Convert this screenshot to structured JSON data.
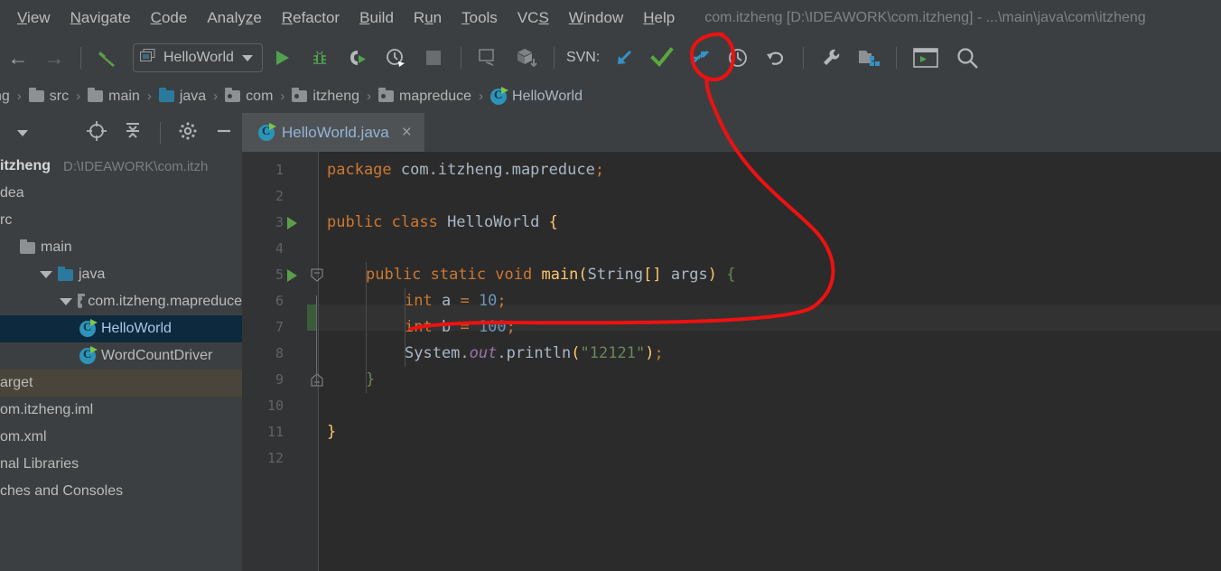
{
  "window": {
    "title": "com.itzheng [D:\\IDEAWORK\\com.itzheng] - ...\\main\\java\\com\\itzheng"
  },
  "menubar": {
    "items": [
      {
        "label": "View",
        "mnemonic": "V"
      },
      {
        "label": "Navigate",
        "mnemonic": "N"
      },
      {
        "label": "Code",
        "mnemonic": "C"
      },
      {
        "label": "Analyze",
        "mnemonic": "z"
      },
      {
        "label": "Refactor",
        "mnemonic": "R"
      },
      {
        "label": "Build",
        "mnemonic": "B"
      },
      {
        "label": "Run",
        "mnemonic": "u"
      },
      {
        "label": "Tools",
        "mnemonic": "T"
      },
      {
        "label": "VCS",
        "mnemonic": "S"
      },
      {
        "label": "Window",
        "mnemonic": "W"
      },
      {
        "label": "Help",
        "mnemonic": "H"
      }
    ]
  },
  "toolbar": {
    "back_icon": "arrow-left-icon",
    "forward_icon": "arrow-right-icon",
    "build_icon": "hammer-icon",
    "run_config": {
      "label": "HelloWorld",
      "icon": "application-icon",
      "caret": "chevron-down-icon"
    },
    "run_icon": "run-icon",
    "debug_icon": "debug-bug-icon",
    "run_coverage_icon": "run-with-coverage-icon",
    "profile_icon": "profiler-icon",
    "stop_icon": "stop-icon",
    "attach_icon": "attach-debugger-icon",
    "update_project_icon": "update-project-icon",
    "svn_label": "SVN:",
    "svn_update_icon": "svn-update-icon",
    "svn_commit_icon": "svn-commit-checkmark-icon",
    "svn_integrate_icon": "svn-integrate-icon",
    "svn_history_icon": "svn-history-clock-icon",
    "svn_rollback_icon": "svn-rollback-icon",
    "settings_icon": "wrench-settings-icon",
    "project_structure_icon": "project-structure-icon",
    "terminal_icon": "terminal-icon",
    "search_icon": "search-icon"
  },
  "breadcrumb": {
    "items": [
      {
        "label": "ng",
        "icon": "none"
      },
      {
        "label": "src",
        "icon": "folder-icon"
      },
      {
        "label": "main",
        "icon": "folder-icon"
      },
      {
        "label": "java",
        "icon": "source-folder-icon"
      },
      {
        "label": "com",
        "icon": "package-icon"
      },
      {
        "label": "itzheng",
        "icon": "package-icon"
      },
      {
        "label": "mapreduce",
        "icon": "package-icon"
      },
      {
        "label": "HelloWorld",
        "icon": "java-class-icon"
      }
    ],
    "separator": "›"
  },
  "project_panel": {
    "toolbar_icons": [
      "chevron-down-icon",
      "locate-target-icon",
      "collapse-all-icon",
      "gear-icon",
      "minimize-icon"
    ],
    "tree": [
      {
        "label": "itzheng",
        "detail": "D:\\IDEAWORK\\com.itzh",
        "icon": "project-root-icon",
        "indent": 0,
        "bold": true,
        "state": "normal"
      },
      {
        "label": "dea",
        "icon": "folder-icon",
        "indent": 1,
        "state": "normal"
      },
      {
        "label": "rc",
        "icon": "folder-icon",
        "indent": 1,
        "state": "normal"
      },
      {
        "label": "main",
        "icon": "folder-icon",
        "indent": 2,
        "state": "normal"
      },
      {
        "label": "java",
        "icon": "source-folder-icon",
        "indent": 3,
        "state": "normal"
      },
      {
        "label": "com.itzheng.mapreduce",
        "icon": "package-icon",
        "indent": 4,
        "state": "normal"
      },
      {
        "label": "HelloWorld",
        "icon": "java-class-icon",
        "indent": 5,
        "state": "selected"
      },
      {
        "label": "WordCountDriver",
        "icon": "java-class-icon",
        "indent": 5,
        "state": "normal"
      },
      {
        "label": "arget",
        "icon": "none",
        "indent": 1,
        "state": "hover"
      },
      {
        "label": "om.itzheng.iml",
        "icon": "none",
        "indent": 1,
        "state": "normal"
      },
      {
        "label": "om.xml",
        "icon": "none",
        "indent": 1,
        "state": "normal"
      },
      {
        "label": "nal Libraries",
        "icon": "none",
        "indent": 0,
        "state": "normal"
      },
      {
        "label": "ches and Consoles",
        "icon": "none",
        "indent": 0,
        "state": "normal"
      }
    ]
  },
  "editor": {
    "tab": {
      "label": "HelloWorld.java",
      "icon": "java-class-icon",
      "close": "×"
    },
    "caret_line": 7,
    "lines": [
      {
        "n": 1,
        "indent": 0,
        "run_marker": false,
        "fold": false,
        "tokens": [
          {
            "t": "package ",
            "c": "kw"
          },
          {
            "t": "com.itzheng.mapreduce",
            "c": "ident"
          },
          {
            "t": ";",
            "c": "semi"
          }
        ]
      },
      {
        "n": 2,
        "indent": 0,
        "run_marker": false,
        "fold": false,
        "tokens": []
      },
      {
        "n": 3,
        "indent": 0,
        "run_marker": true,
        "fold": false,
        "tokens": [
          {
            "t": "public class ",
            "c": "kw"
          },
          {
            "t": "HelloWorld",
            "c": "cls"
          },
          {
            "t": " ",
            "c": "ident"
          },
          {
            "t": "{",
            "c": "brace-y"
          }
        ]
      },
      {
        "n": 4,
        "indent": 0,
        "run_marker": false,
        "fold": false,
        "tokens": []
      },
      {
        "n": 5,
        "indent": 1,
        "run_marker": true,
        "fold": true,
        "tokens": [
          {
            "t": "public static void ",
            "c": "kw"
          },
          {
            "t": "main",
            "c": "fn"
          },
          {
            "t": "(",
            "c": "brace-y"
          },
          {
            "t": "String",
            "c": "cls"
          },
          {
            "t": "[]",
            "c": "brace-y"
          },
          {
            "t": " args",
            "c": "ident"
          },
          {
            "t": ")",
            "c": "brace-y"
          },
          {
            "t": " ",
            "c": "ident"
          },
          {
            "t": "{",
            "c": "brace-g"
          }
        ]
      },
      {
        "n": 6,
        "indent": 2,
        "run_marker": false,
        "fold": false,
        "tokens": [
          {
            "t": "int",
            "c": "kw"
          },
          {
            "t": " a ",
            "c": "ident"
          },
          {
            "t": "=",
            "c": "semi"
          },
          {
            "t": " ",
            "c": "ident"
          },
          {
            "t": "10",
            "c": "num"
          },
          {
            "t": ";",
            "c": "semi"
          }
        ]
      },
      {
        "n": 7,
        "indent": 2,
        "run_marker": false,
        "fold": false,
        "tokens": [
          {
            "t": "int",
            "c": "kw"
          },
          {
            "t": " b ",
            "c": "ident"
          },
          {
            "t": "=",
            "c": "semi"
          },
          {
            "t": " ",
            "c": "ident"
          },
          {
            "t": "100",
            "c": "num"
          },
          {
            "t": ";",
            "c": "semi"
          }
        ]
      },
      {
        "n": 8,
        "indent": 2,
        "run_marker": false,
        "fold": false,
        "tokens": [
          {
            "t": "System",
            "c": "cls"
          },
          {
            "t": ".",
            "c": "ident"
          },
          {
            "t": "out",
            "c": "stat"
          },
          {
            "t": ".println",
            "c": "ident"
          },
          {
            "t": "(",
            "c": "brace-y"
          },
          {
            "t": "\"12121\"",
            "c": "str"
          },
          {
            "t": ")",
            "c": "brace-y"
          },
          {
            "t": ";",
            "c": "semi"
          }
        ]
      },
      {
        "n": 9,
        "indent": 1,
        "run_marker": false,
        "fold": true,
        "tokens": [
          {
            "t": "}",
            "c": "brace-g"
          }
        ]
      },
      {
        "n": 10,
        "indent": 0,
        "run_marker": false,
        "fold": false,
        "tokens": []
      },
      {
        "n": 11,
        "indent": 0,
        "run_marker": false,
        "fold": false,
        "tokens": [
          {
            "t": "}",
            "c": "brace-y"
          }
        ]
      },
      {
        "n": 12,
        "indent": 0,
        "run_marker": false,
        "fold": false,
        "tokens": []
      }
    ]
  },
  "annotation": {
    "color": "#ee1111",
    "description": "hand-drawn red underline under line 7 curving up to circle the SVN commit checkmark"
  }
}
